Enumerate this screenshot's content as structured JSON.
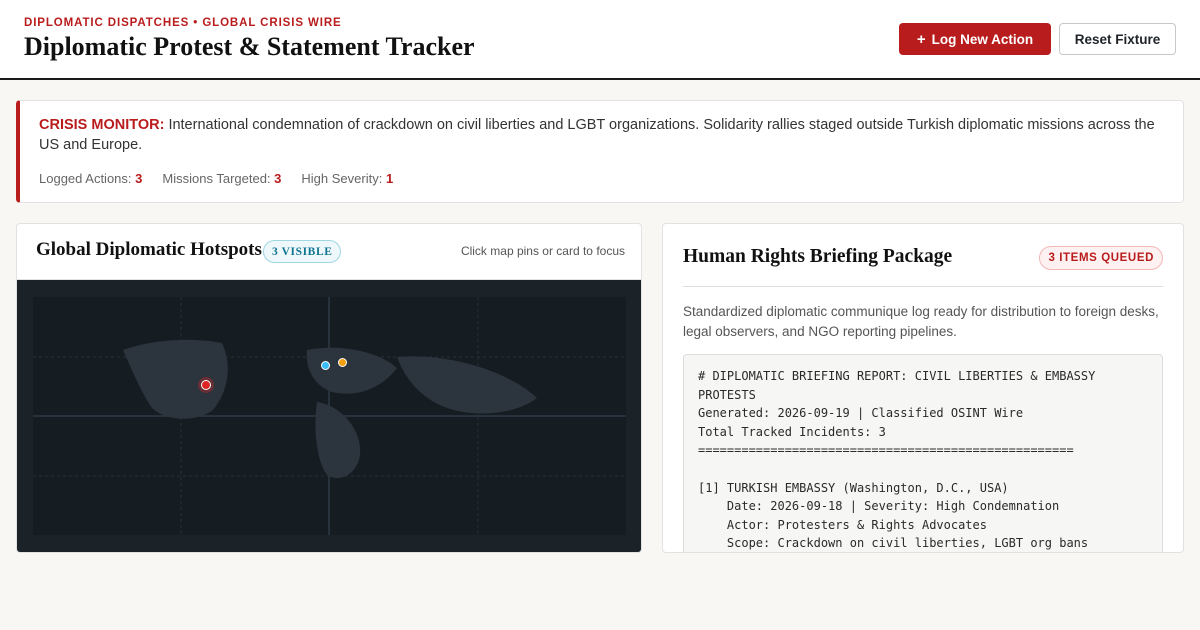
{
  "header": {
    "kicker": "DIPLOMATIC DISPATCHES • GLOBAL CRISIS WIRE",
    "title": "Diplomatic Protest & Statement Tracker",
    "log_button": "Log New Action",
    "reset_button": "Reset Fixture"
  },
  "alert": {
    "label": "CRISIS MONITOR:",
    "text": "International condemnation of crackdown on civil liberties and LGBT organizations. Solidarity rallies staged outside Turkish diplomatic missions across the US and Europe.",
    "stats": [
      {
        "label": "Logged Actions:",
        "value": "3"
      },
      {
        "label": "Missions Targeted:",
        "value": "3"
      },
      {
        "label": "High Severity:",
        "value": "1"
      }
    ]
  },
  "map_panel": {
    "title": "Global Diplomatic Hotspots",
    "badge": "3 VISIBLE",
    "hint": "Click map pins or card to focus",
    "pins": [
      {
        "name": "pin-washington",
        "color": "#dc2626"
      },
      {
        "name": "pin-europe-blue",
        "color": "#38bdf8"
      },
      {
        "name": "pin-europe-amber",
        "color": "#f59e0b"
      }
    ]
  },
  "brief_panel": {
    "title": "Human Rights Briefing Package",
    "badge": "3 ITEMS QUEUED",
    "description": "Standardized diplomatic communique log ready for distribution to foreign desks, legal observers, and NGO reporting pipelines.",
    "report_lines": [
      "# DIPLOMATIC BRIEFING REPORT: CIVIL LIBERTIES & EMBASSY",
      "PROTESTS",
      "Generated: 2026-09-19 | Classified OSINT Wire",
      "Total Tracked Incidents: 3",
      "====================================================",
      "",
      "[1] TURKISH EMBASSY (Washington, D.C., USA)",
      "    Date: 2026-09-18 | Severity: High Condemnation",
      "    Actor: Protesters & Rights Advocates",
      "    Scope: Crackdown on civil liberties, LGBT org bans"
    ]
  },
  "colors": {
    "accent": "#b91c1c",
    "map_bg": "#1b2228",
    "land": "#2c353d"
  }
}
